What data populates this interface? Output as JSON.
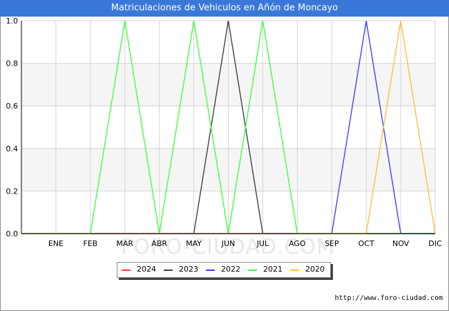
{
  "title": "Matriculaciones de Vehiculos en Añón de Moncayo",
  "source_url": "http://www.foro-ciudad.com",
  "watermark": "FORO-CIUDAD.COM",
  "colors": {
    "title_bar": "#3a78d8",
    "plot_band": "#f5f5f5",
    "grid": "#d4d4d4"
  },
  "chart_data": {
    "type": "line",
    "categories": [
      "",
      "ENE",
      "FEB",
      "MAR",
      "ABR",
      "MAY",
      "JUN",
      "JUL",
      "AGO",
      "SEP",
      "OCT",
      "NOV",
      "DIC"
    ],
    "ylim": [
      0,
      1
    ],
    "yticks": [
      "0.0",
      "0.2",
      "0.4",
      "0.6",
      "0.8",
      "1.0"
    ],
    "grid": true,
    "legend_position": "bottom-center",
    "series": [
      {
        "name": "2024",
        "color": "#ff4040",
        "values": [
          0,
          0,
          0,
          0,
          0,
          0,
          0,
          0,
          0,
          0,
          0,
          0,
          0
        ]
      },
      {
        "name": "2023",
        "color": "#404040",
        "values": [
          0,
          0,
          0,
          0,
          0,
          0,
          1,
          0,
          0,
          0,
          0,
          0,
          0
        ]
      },
      {
        "name": "2022",
        "color": "#4040ff",
        "values": [
          0,
          0,
          0,
          0,
          0,
          0,
          0,
          0,
          0,
          0,
          1,
          0,
          0
        ]
      },
      {
        "name": "2021",
        "color": "#40ff40",
        "values": [
          0,
          0,
          0,
          1,
          0,
          1,
          0,
          1,
          0,
          0,
          0,
          0,
          0
        ]
      },
      {
        "name": "2020",
        "color": "#ffbf40",
        "values": [
          0,
          0,
          0,
          0,
          0,
          0,
          0,
          0,
          0,
          0,
          0,
          1,
          0
        ]
      }
    ]
  }
}
